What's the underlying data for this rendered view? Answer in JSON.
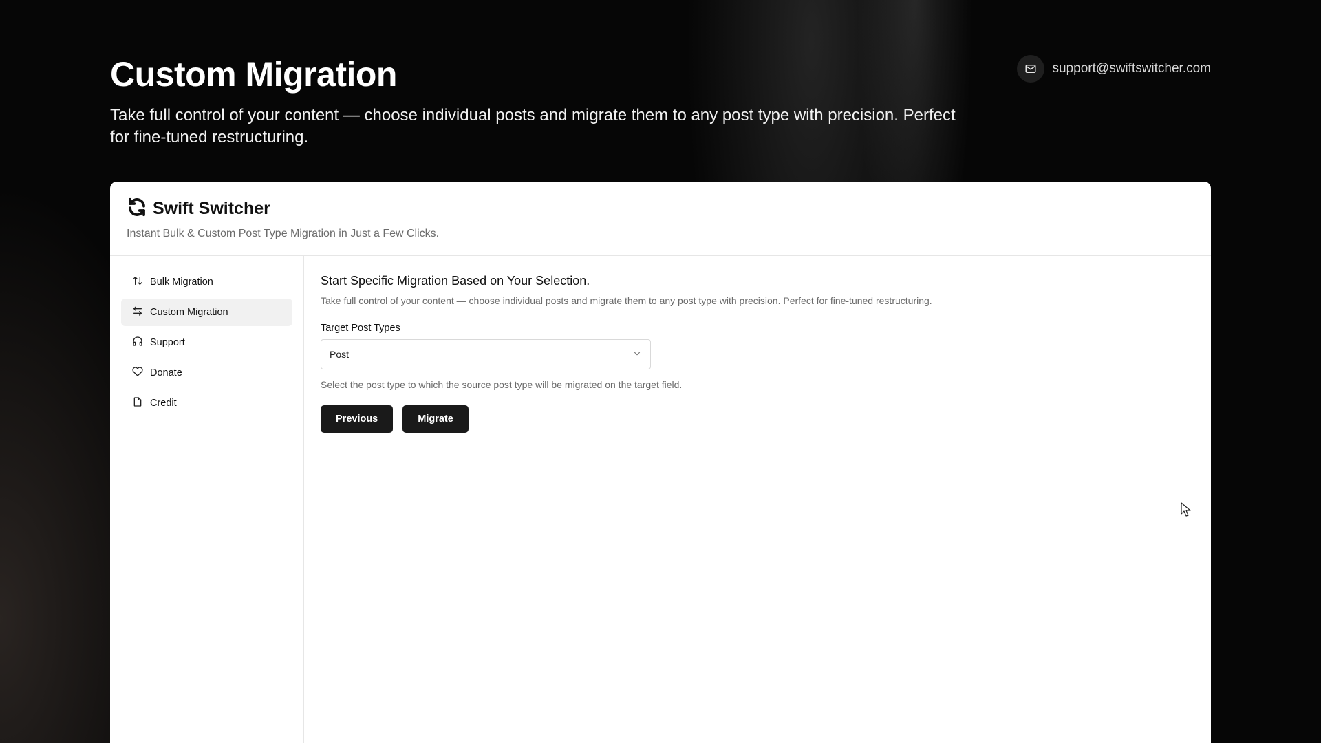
{
  "hero": {
    "title": "Custom Migration",
    "description": "Take full control of your content — choose individual posts and migrate them to any post type with precision. Perfect for fine-tuned restructuring."
  },
  "contact": {
    "email": "support@swiftswitcher.com",
    "icon": "mail-icon"
  },
  "brand": {
    "name": "Swift Switcher",
    "tagline": "Instant Bulk & Custom Post Type Migration in Just a Few Clicks.",
    "icon": "refresh-icon"
  },
  "sidebar": {
    "items": [
      {
        "label": "Bulk Migration",
        "icon": "arrows-up-down-icon",
        "active": false
      },
      {
        "label": "Custom Migration",
        "icon": "arrows-left-right-icon",
        "active": true
      },
      {
        "label": "Support",
        "icon": "headphones-icon",
        "active": false
      },
      {
        "label": "Donate",
        "icon": "heart-icon",
        "active": false
      },
      {
        "label": "Credit",
        "icon": "file-icon",
        "active": false
      }
    ]
  },
  "main": {
    "heading": "Start Specific Migration Based on Your Selection.",
    "description": "Take full control of your content — choose individual posts and migrate them to any post type with precision. Perfect for fine-tuned restructuring.",
    "target_label": "Target Post Types",
    "target_value": "Post",
    "target_hint": "Select the post type to which the source post type will be migrated on the target field.",
    "previous_label": "Previous",
    "migrate_label": "Migrate"
  },
  "colors": {
    "accent": "#1a1a1a",
    "active_nav": "#f1f1f1"
  }
}
